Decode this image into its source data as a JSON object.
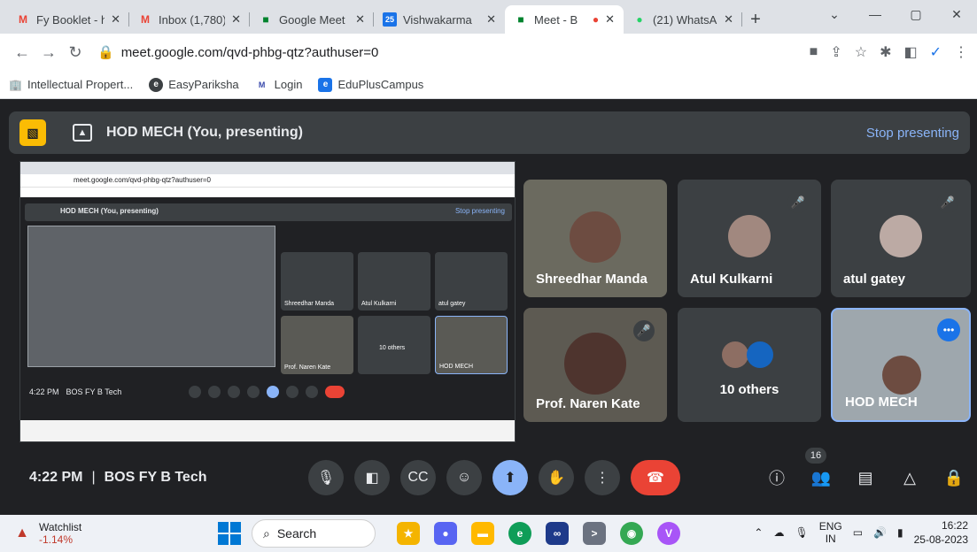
{
  "browser": {
    "tabs": [
      {
        "title": "Fy Booklet - h",
        "favicon": "gmail-icon",
        "active": false
      },
      {
        "title": "Inbox (1,780)",
        "favicon": "gmail-icon",
        "active": false
      },
      {
        "title": "Google Meet",
        "favicon": "meet-icon",
        "active": false
      },
      {
        "title": "Vishwakarma",
        "favicon": "calendar-icon",
        "active": false
      },
      {
        "title": "Meet - B",
        "favicon": "meet-icon",
        "active": true
      },
      {
        "title": "(21) WhatsAp",
        "favicon": "whatsapp-icon",
        "active": false
      }
    ],
    "url": "meet.google.com/qvd-phbg-qtz?authuser=0",
    "bookmarks": [
      "Intellectual Propert...",
      "EasyPariksha",
      "Login",
      "EduPlusCampus"
    ]
  },
  "meet": {
    "presenting_label": "HOD MECH (You, presenting)",
    "stop_presenting": "Stop presenting",
    "participants": [
      {
        "name": "Shreedhar Manda",
        "muted": false
      },
      {
        "name": "Atul Kulkarni",
        "muted": true
      },
      {
        "name": "atul gatey",
        "muted": true
      },
      {
        "name": "Prof. Naren Kate",
        "muted": true
      },
      {
        "name": "10 others",
        "muted": false
      },
      {
        "name": "HOD MECH",
        "muted": false
      }
    ],
    "time": "4:22 PM",
    "meeting_name": "BOS FY B Tech",
    "participant_count": "16"
  },
  "shared_screen": {
    "url": "meet.google.com/qvd-phbg-qtz?authuser=0",
    "bar_label": "HOD MECH (You, presenting)",
    "stop": "Stop presenting",
    "time": "4:22 PM",
    "meeting_name": "BOS FY B Tech",
    "names": [
      "Shreedhar Manda",
      "Atul Kulkarni",
      "atul gatey",
      "Prof. Naren Kate",
      "10 others",
      "HOD MECH"
    ]
  },
  "taskbar": {
    "watchlist": "Watchlist",
    "watchlist_change": "-1.14%",
    "search": "Search",
    "lang1": "ENG",
    "lang2": "IN",
    "time": "16:22",
    "date": "25-08-2023"
  }
}
